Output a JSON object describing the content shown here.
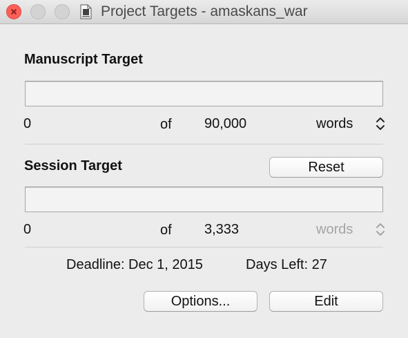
{
  "window": {
    "title": "Project Targets - amaskans_war"
  },
  "manuscript": {
    "heading": "Manuscript Target",
    "current": "0",
    "of_label": "of",
    "target": "90,000",
    "unit": "words"
  },
  "session": {
    "heading": "Session Target",
    "reset_label": "Reset",
    "current": "0",
    "of_label": "of",
    "target": "3,333",
    "unit": "words"
  },
  "footer": {
    "deadline": "Deadline: Dec 1, 2015",
    "days_left": "Days Left: 27",
    "options_label": "Options...",
    "edit_label": "Edit"
  },
  "colors": {
    "close_button": "#fc5f57",
    "disabled_text": "#a4a4a4"
  },
  "icons": {
    "close": "close-icon",
    "document": "scrivener-document-icon",
    "stepper": "up-down-chevron-icon"
  }
}
